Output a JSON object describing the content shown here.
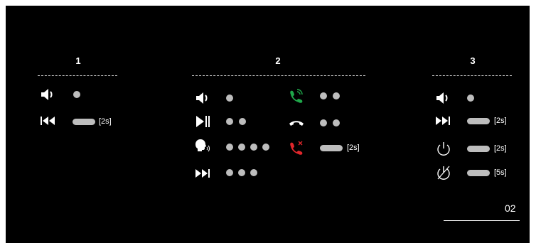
{
  "columns": [
    {
      "title": "1"
    },
    {
      "title": "2"
    },
    {
      "title": "3"
    }
  ],
  "rows": {
    "c1_volume": {
      "icon": "volume-icon",
      "dots": 1
    },
    "c1_previous": {
      "icon": "previous-track-icon",
      "hold": true,
      "hold_label": "[2s]"
    },
    "c2_volume": {
      "icon": "volume-icon",
      "dots": 1
    },
    "c2_playpause": {
      "icon": "play-pause-icon",
      "dots": 2
    },
    "c2_voice": {
      "icon": "voice-assistant-icon",
      "dots": 4
    },
    "c2_next": {
      "icon": "next-track-icon",
      "dots": 3
    },
    "c2_answer": {
      "icon": "answer-call-icon",
      "dots": 2
    },
    "c2_hangup": {
      "icon": "end-call-icon",
      "dots": 2
    },
    "c2_reject": {
      "icon": "reject-call-icon",
      "hold": true,
      "hold_label": "[2s]"
    },
    "c3_volume": {
      "icon": "volume-icon",
      "dots": 1
    },
    "c3_next": {
      "icon": "next-track-icon",
      "hold": true,
      "hold_label": "[2s]"
    },
    "c3_power": {
      "icon": "power-on-icon",
      "hold": true,
      "hold_label": "[2s]"
    },
    "c3_poweroff": {
      "icon": "power-off-icon",
      "hold": true,
      "hold_label": "[5s]"
    }
  },
  "colors": {
    "background": "#000000",
    "indicator": "#bdbdbd",
    "answer": "#1fa64a",
    "reject": "#e0262b"
  },
  "page_number": "02"
}
